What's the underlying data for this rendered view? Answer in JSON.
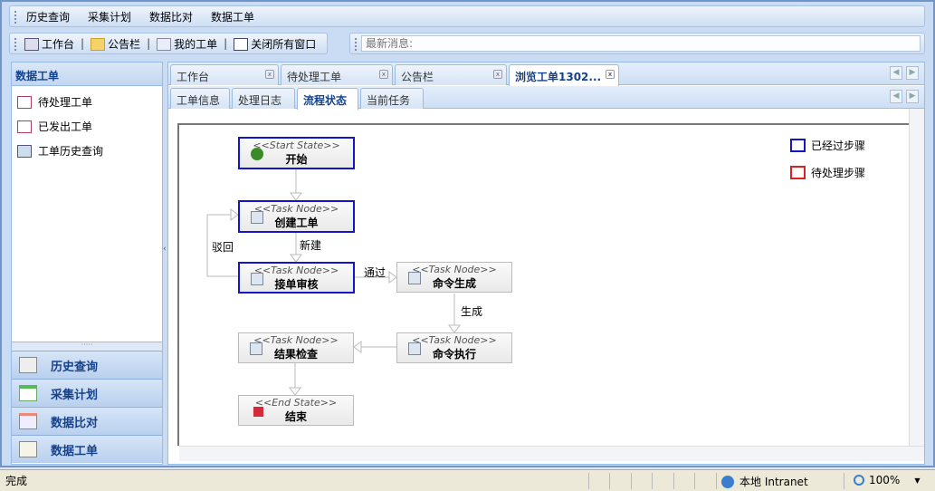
{
  "menu": [
    "历史查询",
    "采集计划",
    "数据比对",
    "数据工单"
  ],
  "toolbar": {
    "workbench": "工作台",
    "notice": "公告栏",
    "my_orders": "我的工单",
    "close_all": "关闭所有窗口",
    "sep": "|"
  },
  "message": {
    "placeholder": "最新消息:"
  },
  "left_panel": {
    "title": "数据工单",
    "items": [
      "待处理工单",
      "已发出工单",
      "工单历史查询"
    ],
    "accordion": [
      "历史查询",
      "采集计划",
      "数据比对",
      "数据工单"
    ]
  },
  "tabs": [
    "工作台",
    "待处理工单",
    "公告栏",
    "浏览工单1302..."
  ],
  "subtabs": [
    "工单信息",
    "处理日志",
    "流程状态",
    "当前任务"
  ],
  "diagram": {
    "nodes": [
      {
        "stereotype": "<<Start State>>",
        "name": "开始",
        "status": "passed"
      },
      {
        "stereotype": "<<Task Node>>",
        "name": "创建工单",
        "status": "passed"
      },
      {
        "stereotype": "<<Task Node>>",
        "name": "接单审核",
        "status": "passed"
      },
      {
        "stereotype": "<<Task Node>>",
        "name": "命令生成",
        "status": "none"
      },
      {
        "stereotype": "<<Task Node>>",
        "name": "命令执行",
        "status": "none"
      },
      {
        "stereotype": "<<Task Node>>",
        "name": "结果检查",
        "status": "none"
      },
      {
        "stereotype": "<<End State>>",
        "name": "结束",
        "status": "none"
      }
    ],
    "edges": {
      "create_to_accept": "新建",
      "reject": "驳回",
      "pass": "通过",
      "generate": "生成"
    },
    "legend": [
      {
        "label": "已经过步骤",
        "color": "#1515c8"
      },
      {
        "label": "待处理步骤",
        "color": "#e02020"
      }
    ]
  },
  "status": {
    "text": "完成",
    "zone": "本地 Intranet",
    "zoom": "100%"
  }
}
